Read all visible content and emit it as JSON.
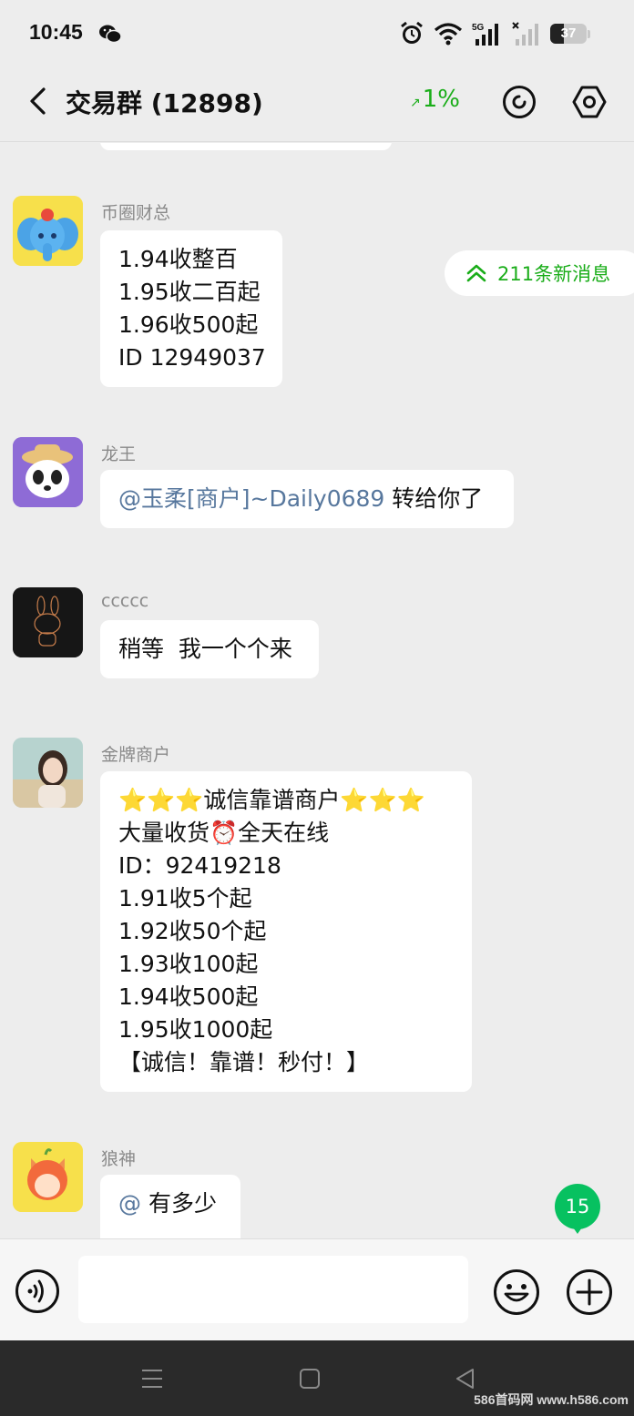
{
  "status": {
    "time": "10:45",
    "battery": "37",
    "network_label": "5G"
  },
  "header": {
    "title": "交易群 (12898)",
    "rate": "1%"
  },
  "new_messages": "211条新消息",
  "messages": [
    {
      "sender": "币圈财总",
      "lines": [
        "1.94收整百",
        "1.95收二百起",
        "1.96收500起",
        "ID 12949037"
      ]
    },
    {
      "sender": "龙王",
      "mention": "@玉柔[商户]~Daily0689",
      "text": " 转给你了"
    },
    {
      "sender": "ccccc",
      "lines": [
        "稍等  我一个个来"
      ]
    },
    {
      "sender": "金牌商户",
      "lines": [
        "⭐⭐⭐诚信靠谱商户⭐⭐⭐",
        "大量收货⏰全天在线",
        "ID：92419218",
        "1.91收5个起",
        "1.92收50个起",
        "1.93收100起",
        "1.94收500起",
        "1.95收1000起",
        "【诚信！靠谱！秒付！】"
      ]
    },
    {
      "sender": "狼神",
      "mention": "@",
      "text": " 有多少"
    }
  ],
  "unread_count": "15",
  "input": {
    "value": ""
  },
  "watermark": "586首码网 www.h586.com",
  "colors": {
    "accent_green": "#07c160",
    "mention_blue": "#57779d",
    "background": "#ededed"
  },
  "icons": [
    "back-icon",
    "refresh-icon",
    "settings-icon",
    "double-chevron-up-icon",
    "voice-icon",
    "emoji-icon",
    "plus-icon",
    "nav-menu-icon",
    "nav-home-icon",
    "nav-back-icon"
  ]
}
